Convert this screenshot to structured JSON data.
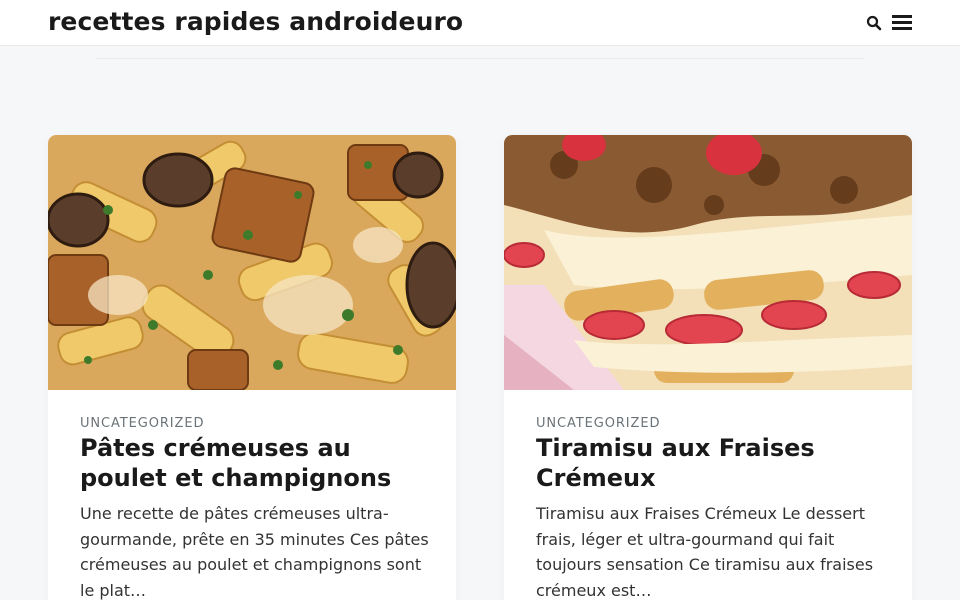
{
  "site": {
    "title": "recettes rapides androideuro"
  },
  "header": {
    "search_icon": "search-icon",
    "menu_icon": "hamburger-menu-icon"
  },
  "posts": [
    {
      "category": "UNCATEGORIZED",
      "title": "Pâtes crémeuses au poulet et champignons",
      "excerpt": "Une recette de  pâtes crémeuses ultra-gourmande, prête en 35 minutes Ces pâtes crémeuses au poulet et champignons sont le plat…"
    },
    {
      "category": "UNCATEGORIZED",
      "title": "Tiramisu aux Fraises Crémeux",
      "excerpt": "Tiramisu aux Fraises Crémeux Le dessert frais, léger et ultra-gourmand qui fait toujours sensation Ce  tiramisu aux fraises crémeux est…"
    }
  ],
  "colors": {
    "background": "#f5f7f9",
    "header": "#ffffff",
    "text": "#1a1a1a",
    "meta": "#6b7378"
  }
}
